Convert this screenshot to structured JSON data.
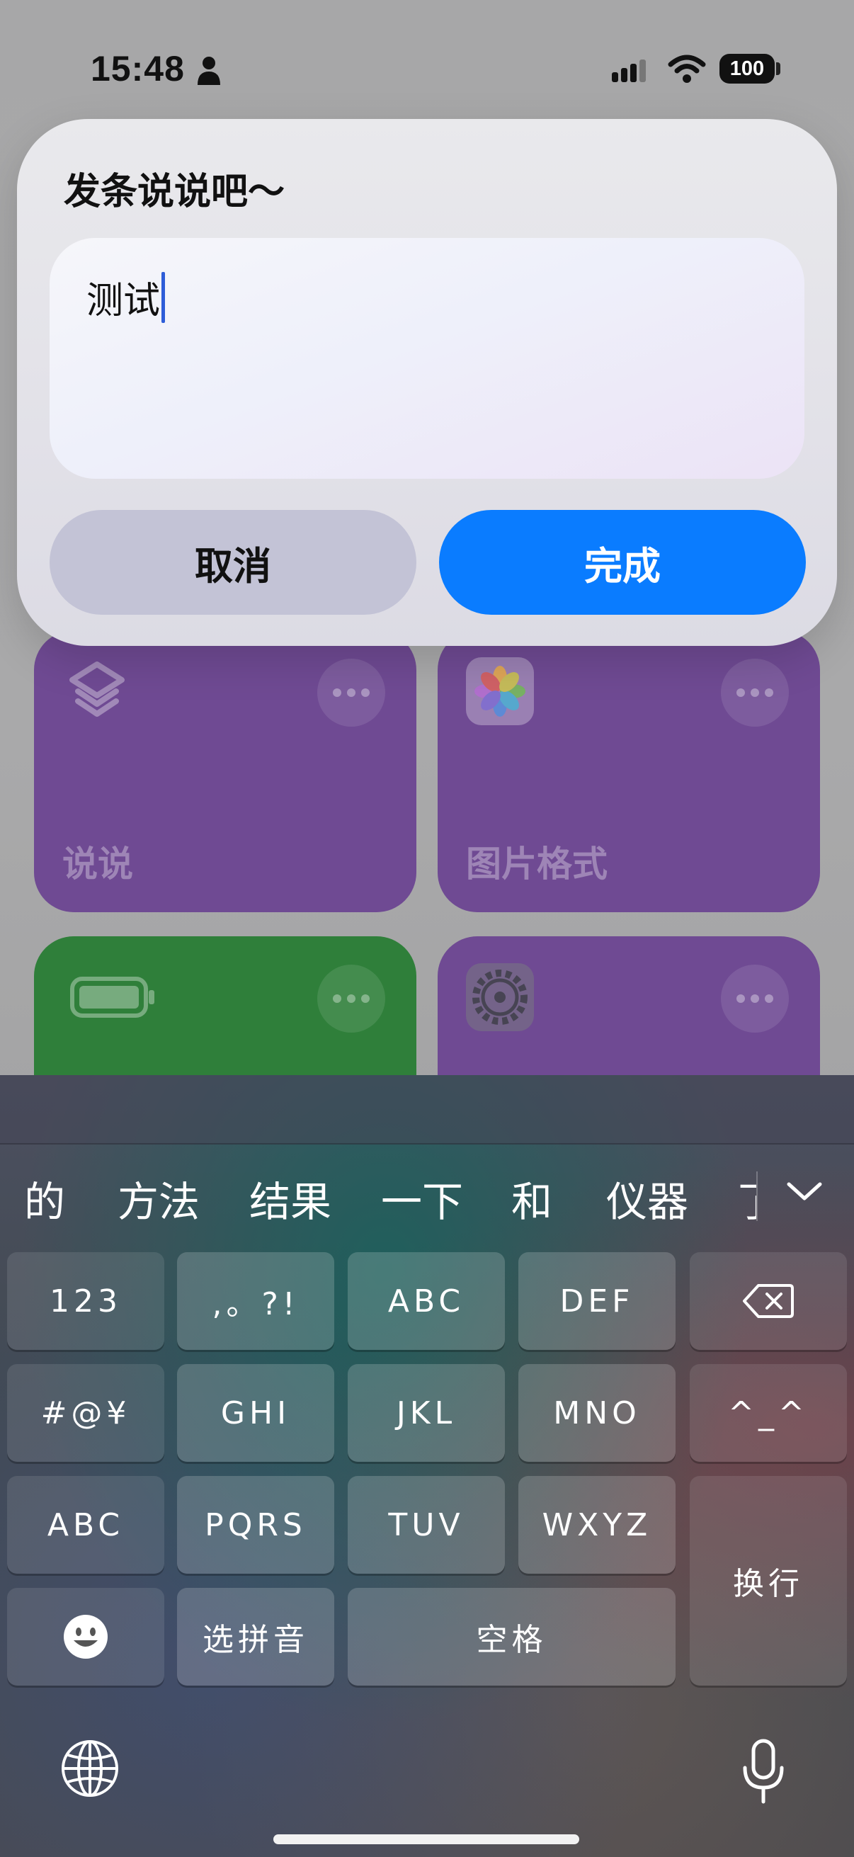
{
  "status_bar": {
    "time": "15:48",
    "battery": "100"
  },
  "dialog": {
    "title": "发条说说吧～",
    "input_value": "测试",
    "cancel_label": "取消",
    "done_label": "完成"
  },
  "tiles": [
    {
      "label": "说说",
      "icon": "layers-icon",
      "color": "#6f4a93"
    },
    {
      "label": "图片格式",
      "icon": "photos-icon",
      "color": "#6f4a93"
    },
    {
      "label": "",
      "icon": "battery-icon",
      "color": "#2f7f3a"
    },
    {
      "label": "",
      "icon": "settings-gear-icon",
      "color": "#6f4a93"
    }
  ],
  "keyboard": {
    "candidates": [
      "的",
      "方法",
      "结果",
      "一下",
      "和",
      "仪器",
      "了"
    ],
    "rows": [
      [
        "123",
        ",。?!",
        "ABC",
        "DEF",
        "delete"
      ],
      [
        "#@¥",
        "GHI",
        "JKL",
        "MNO",
        "^_^"
      ],
      [
        "ABC",
        "PQRS",
        "TUV",
        "WXYZ",
        "换行"
      ],
      [
        "emoji",
        "选拼音",
        "空格"
      ]
    ],
    "keys": {
      "num": "123",
      "punct": ",。?!",
      "abc1": "ABC",
      "def": "DEF",
      "symbols": "#@¥",
      "ghi": "GHI",
      "jkl": "JKL",
      "mno": "MNO",
      "kaomoji": "^_^",
      "abc2": "ABC",
      "pqrs": "PQRS",
      "tuv": "TUV",
      "wxyz": "WXYZ",
      "return": "换行",
      "pinyin": "选拼音",
      "space": "空格"
    }
  }
}
